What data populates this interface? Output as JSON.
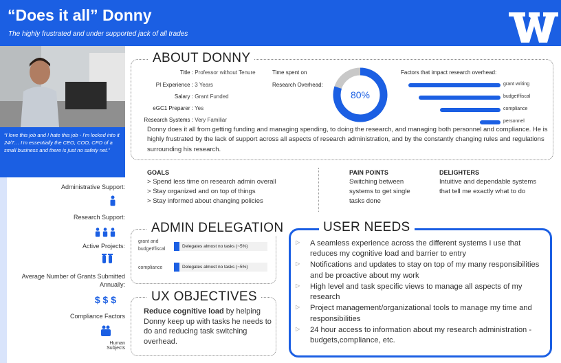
{
  "header": {
    "title": "“Does it all” Donny",
    "subtitle": "The highly frustrated and under supported jack of all trades",
    "brand_color": "#1b5fe3"
  },
  "sidebar": {
    "quote": "“I love this job and I hate this job - I'm locked into it 24/7… I'm essentially the CEO, COO, CFO of a small business and there is just no safety net.”",
    "items": [
      {
        "label": "Administrative Support:",
        "icon": "person-icon"
      },
      {
        "label": "Research Support:",
        "icon": "people-icon"
      },
      {
        "label": "Active Projects:",
        "icon": "beaker-icon"
      },
      {
        "label": "Average Number of Grants Submitted Annually:",
        "icon": "dollar-icon",
        "icon_text": "$ $ $"
      },
      {
        "label": "Compliance Factors",
        "icon": "human-subjects-icon",
        "caption": "Human Subjects"
      }
    ]
  },
  "about": {
    "title": "ABOUT DONNY",
    "fields": [
      {
        "key": "Title :",
        "value": "Professor without Tenure"
      },
      {
        "key": "PI Experience :",
        "value": "3 Years"
      },
      {
        "key": "Salary :",
        "value": "Grant Funded"
      },
      {
        "key": "eGC1 Preparer :",
        "value": "Yes"
      },
      {
        "key": "Research Systems :",
        "value": "Very Familiar"
      }
    ],
    "time_label_1": "Time spent on",
    "time_label_2": "Research Overhead:",
    "time_percent": "80%",
    "time_fraction": 0.8,
    "factors_title": "Factors that impact research overhead:",
    "factors": [
      {
        "label": "grant writing",
        "value": 0.88
      },
      {
        "label": "budget/fiscal",
        "value": 0.78
      },
      {
        "label": "compliance",
        "value": 0.58
      },
      {
        "label": "personnel",
        "value": 0.2
      }
    ],
    "description": "Donny does it all from getting funding and managing spending, to doing the research, and managing both personnel and compliance. He is highly frustrated by the lack of support across all aspects of research administration, and by the constantly changing rules and regulations surrounding his research."
  },
  "goals": {
    "title": "GOALS",
    "items": [
      "Spend less time on research admin overall",
      "Stay organized and on top of things",
      "Stay informed about changing policies"
    ]
  },
  "pain_points": {
    "title": "PAIN POINTS",
    "text": "Switching between systems to get single tasks done"
  },
  "delighters": {
    "title": "DELIGHTERS",
    "text": "Intuitive and dependable systems that tell me exactly what to do"
  },
  "admin_delegation": {
    "title": "ADMIN DELEGATION",
    "rows": [
      {
        "label": "grant and budget/fiscal",
        "bar": "Delegates almost no tasks (~5%)"
      },
      {
        "label": "compliance",
        "bar": "Delegates almost no tasks (~5%)"
      }
    ]
  },
  "ux_objectives": {
    "title": "UX OBJECTIVES",
    "bold": "Reduce cognitive load",
    "text": " by helping Donny keep up with tasks he needs to do and reducing task switching overhead."
  },
  "user_needs": {
    "title": "USER NEEDS",
    "items": [
      "A seamless experience across the different systems I use that reduces my cognitive load and barrier to entry",
      "Notifications and updates to stay on top of my many responsibilities and be proactive about my work",
      "High level and task specific views to manage all aspects of my research",
      "Project management/organizational tools to manage my time and responsibilities",
      "24 hour access to information about my research administration - budgets,compliance, etc."
    ]
  }
}
